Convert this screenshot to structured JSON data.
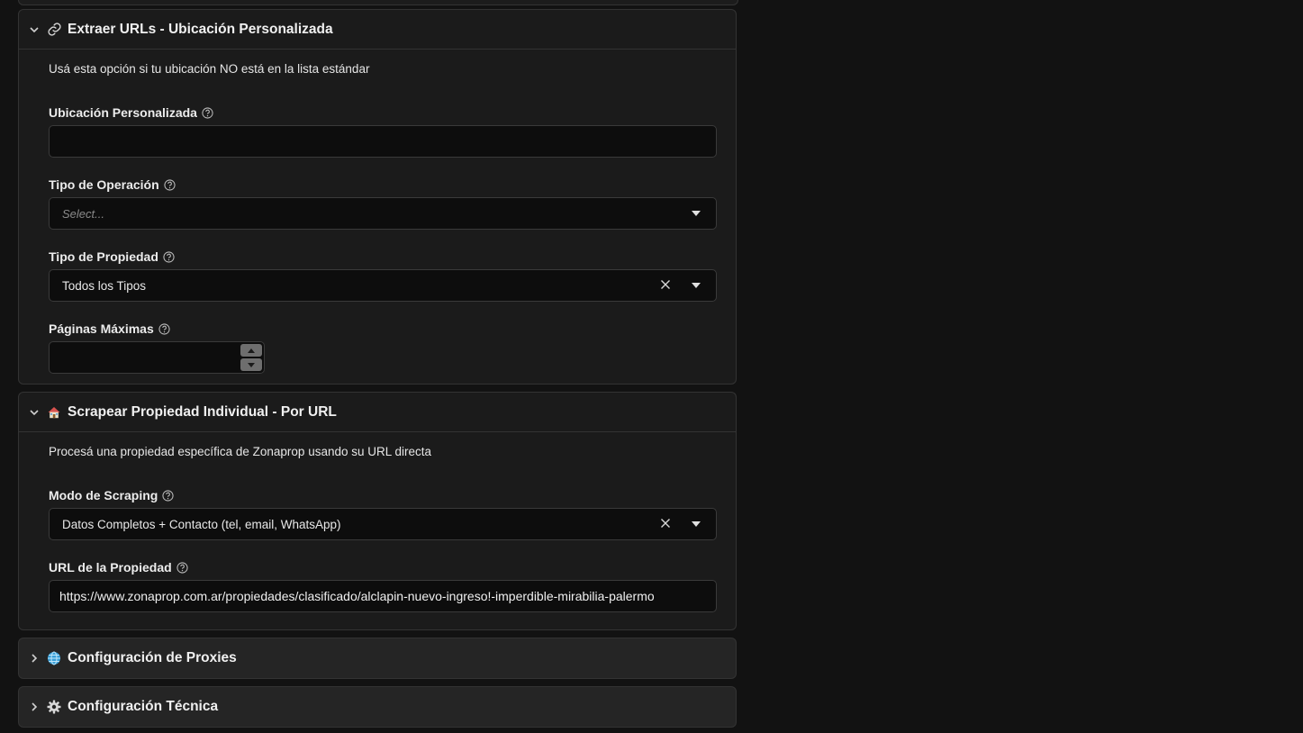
{
  "section_custom_location": {
    "title": "Extraer URLs - Ubicación Personalizada",
    "description": "Usá esta opción si tu ubicación NO está en la lista estándar",
    "fields": {
      "custom_location": {
        "label": "Ubicación Personalizada",
        "value": ""
      },
      "operation_type": {
        "label": "Tipo de Operación",
        "placeholder": "Select..."
      },
      "property_type": {
        "label": "Tipo de Propiedad",
        "value": "Todos los Tipos"
      },
      "max_pages": {
        "label": "Páginas Máximas",
        "value": ""
      }
    }
  },
  "section_single_property": {
    "title": "Scrapear Propiedad Individual - Por URL",
    "description": "Procesá una propiedad específica de Zonaprop usando su URL directa",
    "fields": {
      "scraping_mode": {
        "label": "Modo de Scraping",
        "value": "Datos Completos + Contacto (tel, email, WhatsApp)"
      },
      "property_url": {
        "label": "URL de la Propiedad",
        "value": "https://www.zonaprop.com.ar/propiedades/clasificado/alclapin-nuevo-ingreso!-imperdible-mirabilia-palermo"
      }
    }
  },
  "section_proxies": {
    "title": "Configuración de Proxies"
  },
  "section_technical": {
    "title": "Configuración Técnica"
  },
  "icons": {
    "section_custom_location": "link-icon",
    "section_single_property": "house-icon",
    "section_proxies": "globe-icon",
    "section_technical": "gear-icon"
  },
  "colors": {
    "background": "#121212",
    "panel": "#1b1b1b",
    "input": "#0d0d0d",
    "border": "#333333"
  }
}
